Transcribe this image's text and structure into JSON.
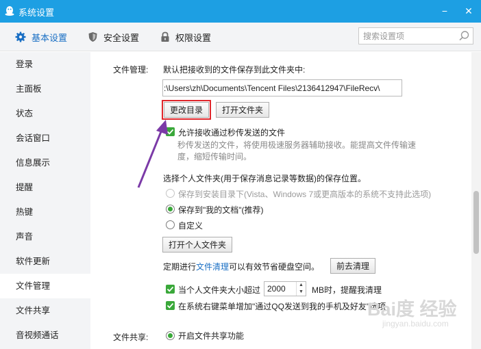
{
  "window": {
    "title": "系统设置",
    "min_label": "−",
    "close_label": "✕",
    "accent": "#1d9fe3"
  },
  "toolbar": {
    "tabs": [
      {
        "label": "基本设置",
        "icon": "gear-icon",
        "active": true
      },
      {
        "label": "安全设置",
        "icon": "shield-icon",
        "active": false
      },
      {
        "label": "权限设置",
        "icon": "lock-icon",
        "active": false
      }
    ],
    "search_placeholder": "搜索设置项"
  },
  "sidebar": {
    "items": [
      {
        "label": "登录"
      },
      {
        "label": "主面板"
      },
      {
        "label": "状态"
      },
      {
        "label": "会话窗口"
      },
      {
        "label": "信息展示"
      },
      {
        "label": "提醒"
      },
      {
        "label": "热键"
      },
      {
        "label": "声音"
      },
      {
        "label": "软件更新"
      },
      {
        "label": "文件管理",
        "active": true
      },
      {
        "label": "文件共享"
      },
      {
        "label": "音视频通话"
      }
    ]
  },
  "file_mgmt": {
    "section_label": "文件管理:",
    "save_desc": "默认把接收到的文件保存到此文件夹中:",
    "path_value": ":\\Users\\zh\\Documents\\Tencent Files\\2136412947\\FileRecv\\",
    "change_dir_btn": "更改目录",
    "open_folder_btn": "打开文件夹",
    "allow_fast_label": "允许接收通过秒传发送的文件",
    "allow_fast_desc": "秒传发送的文件，将使用极速服务器辅助接收。能提高文件传输速度，缩短传输时间。",
    "personal_title": "选择个人文件夹(用于保存消息记录等数据)的保存位置。",
    "radio_install": "保存到安装目录下(Vista、Windows 7或更高版本的系统不支持此选项)",
    "radio_mydocs": "保存到\"我的文档\"(推荐)",
    "radio_custom": "自定义",
    "open_personal_btn": "打开个人文件夹",
    "cleanup_prefix": "定期进行",
    "cleanup_link": "文件清理",
    "cleanup_suffix": "可以有效节省硬盘空间。",
    "goto_clean_btn": "前去清理",
    "size_prefix": "当个人文件夹大小超过",
    "size_value": "2000",
    "size_suffix": "MB时，提醒我清理",
    "context_menu_label": "在系统右键菜单增加\"通过QQ发送到我的手机及好友\"选项"
  },
  "file_share": {
    "section_label": "文件共享:",
    "enable_label": "开启文件共享功能"
  },
  "watermark": {
    "text": "Bai度 经验",
    "sub": "jingyan.baidu.com"
  },
  "colors": {
    "check": "#3aa83a",
    "highlight_box": "#e0262b",
    "annotation_arrow": "#7b3aa7",
    "link": "#1a6fc4"
  }
}
